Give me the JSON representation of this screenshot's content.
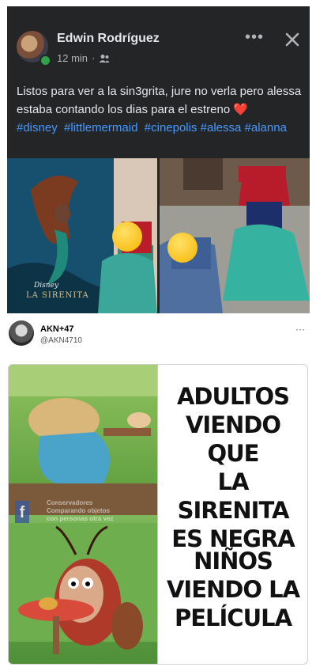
{
  "facebook_post": {
    "author": "Edwin Rodríguez",
    "time": "12 min",
    "separator": "·",
    "privacy_icon": "friends-icon",
    "more_label": "•••",
    "close_icon": "close-icon",
    "text_plain": "Listos para ver a la sin3grita, jure no verla pero alessa estaba contando los dias para el estreno ",
    "heart": "❤️",
    "hashtags": [
      "#disney",
      "#littlemermaid",
      "#cinepolis",
      "#alessa",
      "#alanna"
    ],
    "photo_left_caption": "LA SIRENITA",
    "photo_left_brand": "Disney"
  },
  "tweet": {
    "name": "AKN+47",
    "handle": "@AKN4710",
    "more_label": "···"
  },
  "meme": {
    "top_text_lines": [
      "ADULTOS",
      "VIENDO QUE",
      "LA SIRENITA",
      "ES NEGRA"
    ],
    "bottom_text_lines": [
      "NIÑOS",
      "VIENDO LA",
      "PELÍCULA"
    ],
    "watermark_lines": [
      "Conservadores",
      "Comparando objetos",
      "con personas otra vez"
    ],
    "fb_logo": "f"
  },
  "colors": {
    "fb_background": "#242526",
    "hashtag": "#4599ff",
    "online": "#31a24c"
  }
}
